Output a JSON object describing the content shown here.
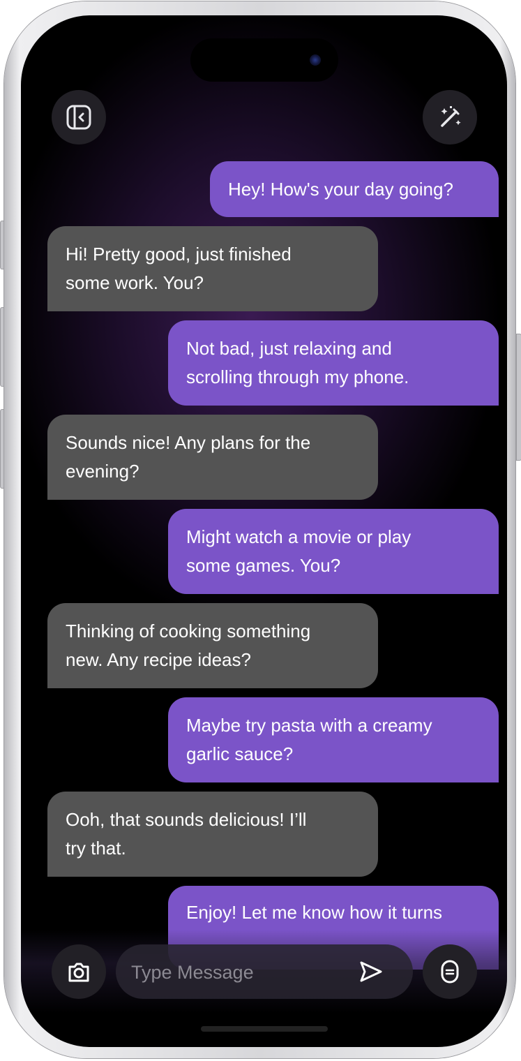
{
  "toolbar": {
    "left_icon": "sidebar-collapse-icon",
    "right_icon": "magic-wand-icon"
  },
  "messages": [
    {
      "side": "out",
      "text": "Hey! How's your day going?"
    },
    {
      "side": "in",
      "lines": [
        "Hi! Pretty good, just finished",
        "some work. You?"
      ]
    },
    {
      "side": "out",
      "lines": [
        "Not bad, just relaxing and",
        "scrolling through my phone."
      ]
    },
    {
      "side": "in",
      "lines": [
        "Sounds nice! Any plans for the",
        "evening?"
      ]
    },
    {
      "side": "out",
      "lines": [
        "Might watch a movie or play",
        "some games. You?"
      ]
    },
    {
      "side": "in",
      "lines": [
        "Thinking of cooking something",
        "new. Any recipe ideas?"
      ]
    },
    {
      "side": "out",
      "lines": [
        "Maybe try pasta with a creamy",
        "garlic sauce?"
      ]
    },
    {
      "side": "in",
      "lines": [
        "Ooh, that sounds delicious! I’ll",
        "try that."
      ]
    },
    {
      "side": "out",
      "lines": [
        "Enjoy! Let me know how it turns"
      ]
    }
  ],
  "composer": {
    "placeholder": "Type Message",
    "camera_icon": "camera-icon",
    "send_icon": "send-icon",
    "mic_icon": "microphone-icon"
  },
  "colors": {
    "outgoing_bubble": "#7b54c8",
    "incoming_bubble": "#545454",
    "background": "#000000"
  }
}
